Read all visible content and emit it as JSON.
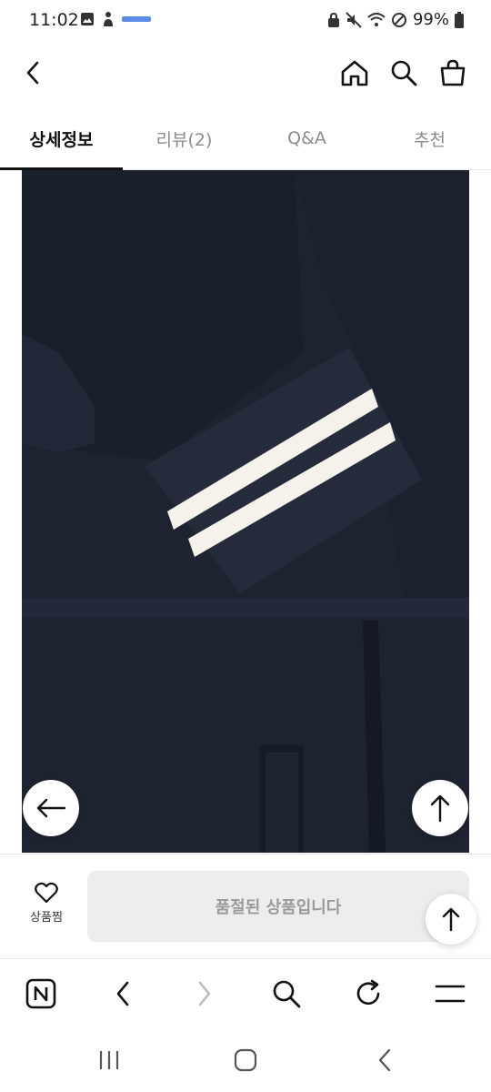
{
  "status_bar": {
    "time": "11:02",
    "battery": "99%",
    "icons": [
      "gallery-icon",
      "person-icon",
      "app-badge-icon",
      "lock-icon",
      "mute-icon",
      "wifi-icon",
      "no-disturb-icon",
      "battery-icon"
    ]
  },
  "header": {
    "icons": [
      "back-icon",
      "home-icon",
      "search-icon",
      "cart-icon"
    ]
  },
  "tabs": [
    {
      "label": "상세정보",
      "active": true
    },
    {
      "label": "리뷰(2)",
      "active": false
    },
    {
      "label": "Q&A",
      "active": false
    },
    {
      "label": "추천",
      "active": false
    }
  ],
  "product_image": {
    "description_icon": "navy-knit-sleeve",
    "colors": {
      "fabric": "#1d2230",
      "stripe": "#f4f2ea"
    }
  },
  "floating": {
    "left_icon": "arrow-left-icon",
    "right_icon": "arrow-up-icon"
  },
  "bottom_bar": {
    "wish_label": "상품찜",
    "soldout_label": "품절된 상품입니다"
  },
  "browser_nav": {
    "icons": [
      "naver-n-icon",
      "back-icon",
      "forward-icon",
      "search-icon",
      "refresh-icon",
      "menu-icon"
    ]
  },
  "system_nav": {
    "icons": [
      "recents-icon",
      "home-icon",
      "back-icon"
    ]
  }
}
